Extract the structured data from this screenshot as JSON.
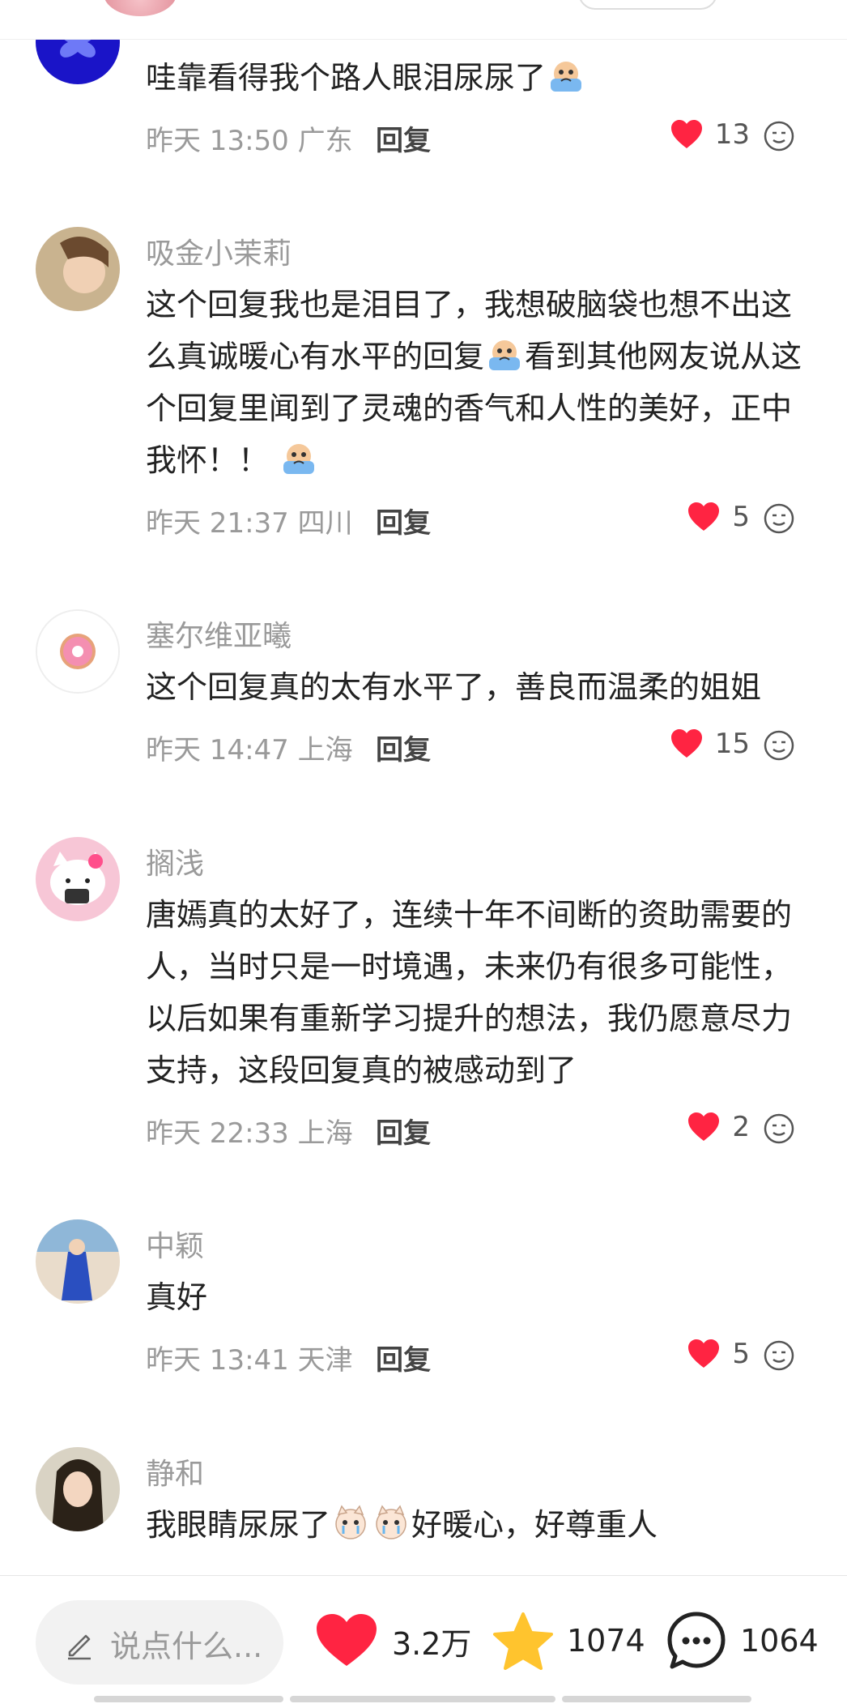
{
  "comments": [
    {
      "username": "",
      "text": "哇靠看得我个路人眼泪尿尿了",
      "time": "昨天 13:50 广东",
      "reply_label": "回复",
      "likes": "13"
    },
    {
      "username": "吸金小茉莉",
      "text_part1": "这个回复我也是泪目了，我想破脑袋也想不出这么真诚暖心有水平的回复",
      "text_part2": "看到其他网友说从这个回复里闻到了灵魂的香气和人性的美好，正中我怀！！",
      "time": "昨天 21:37 四川",
      "reply_label": "回复",
      "likes": "5"
    },
    {
      "username": "塞尔维亚曦",
      "text": "这个回复真的太有水平了，善良而温柔的姐姐",
      "time": "昨天 14:47 上海",
      "reply_label": "回复",
      "likes": "15"
    },
    {
      "username": "搁浅",
      "text": "唐嫣真的太好了，连续十年不间断的资助需要的人，当时只是一时境遇，未来仍有很多可能性，以后如果有重新学习提升的想法，我仍愿意尽力支持，这段回复真的被感动到了",
      "time": "昨天 22:33 上海",
      "reply_label": "回复",
      "likes": "2"
    },
    {
      "username": "中颖",
      "text": "真好",
      "time": "昨天 13:41 天津",
      "reply_label": "回复",
      "likes": "5"
    },
    {
      "username": "静和",
      "text_part1": "我眼睛尿尿了",
      "text_part2": "好暖心，好尊重人",
      "time": "",
      "reply_label": "",
      "likes": ""
    }
  ],
  "bottom_bar": {
    "input_placeholder": "说点什么...",
    "likes_count": "3.2万",
    "favorites_count": "1074",
    "comments_count": "1064"
  },
  "colors": {
    "like_red": "#ff2442",
    "star_yellow": "#ffc42e",
    "meta_gray": "#9a9a9a",
    "text_dark": "#222222"
  },
  "icons": [
    "heart-icon",
    "star-icon",
    "chat-bubble-icon",
    "pencil-icon",
    "crying-emoji",
    "crying-cat-emoji",
    "react-face-icon"
  ]
}
